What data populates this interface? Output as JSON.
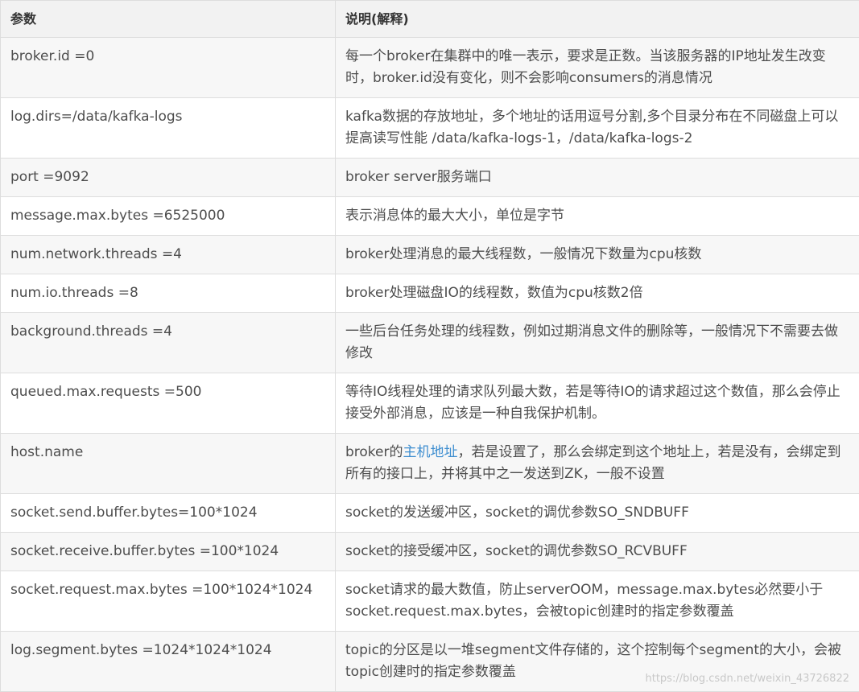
{
  "header": {
    "param": "参数",
    "desc": "说明(解释)"
  },
  "rows": [
    {
      "param": "broker.id =0",
      "desc": "每一个broker在集群中的唯一表示，要求是正数。当该服务器的IP地址发生改变时，broker.id没有变化，则不会影响consumers的消息情况"
    },
    {
      "param": "log.dirs=/data/kafka-logs",
      "desc": "kafka数据的存放地址，多个地址的话用逗号分割,多个目录分布在不同磁盘上可以提高读写性能  /data/kafka-logs-1，/data/kafka-logs-2"
    },
    {
      "param": "port =9092",
      "desc": "broker server服务端口"
    },
    {
      "param": "message.max.bytes =6525000",
      "desc": "表示消息体的最大大小，单位是字节"
    },
    {
      "param": "num.network.threads =4",
      "desc": "broker处理消息的最大线程数，一般情况下数量为cpu核数"
    },
    {
      "param": "num.io.threads =8",
      "desc": "broker处理磁盘IO的线程数，数值为cpu核数2倍"
    },
    {
      "param": "background.threads =4",
      "desc": "一些后台任务处理的线程数，例如过期消息文件的删除等，一般情况下不需要去做修改"
    },
    {
      "param": "queued.max.requests =500",
      "desc": "等待IO线程处理的请求队列最大数，若是等待IO的请求超过这个数值，那么会停止接受外部消息，应该是一种自我保护机制。"
    },
    {
      "param": "host.name",
      "desc_before": "broker的",
      "desc_link": "主机地址",
      "desc_after": "，若是设置了，那么会绑定到这个地址上，若是没有，会绑定到所有的接口上，并将其中之一发送到ZK，一般不设置"
    },
    {
      "param": "socket.send.buffer.bytes=100*1024",
      "desc": "socket的发送缓冲区，socket的调优参数SO_SNDBUFF"
    },
    {
      "param": "socket.receive.buffer.bytes =100*1024",
      "desc": "socket的接受缓冲区，socket的调优参数SO_RCVBUFF"
    },
    {
      "param": "socket.request.max.bytes =100*1024*1024",
      "desc": "socket请求的最大数值，防止serverOOM，message.max.bytes必然要小于socket.request.max.bytes，会被topic创建时的指定参数覆盖"
    },
    {
      "param": "log.segment.bytes =1024*1024*1024",
      "desc": "topic的分区是以一堆segment文件存储的，这个控制每个segment的大小，会被topic创建时的指定参数覆盖"
    }
  ],
  "watermark": "https://blog.csdn.net/weixin_43726822",
  "colors": {
    "link": "#3e8ed0",
    "border": "#dddddd",
    "stripe": "#f7f7f7"
  }
}
